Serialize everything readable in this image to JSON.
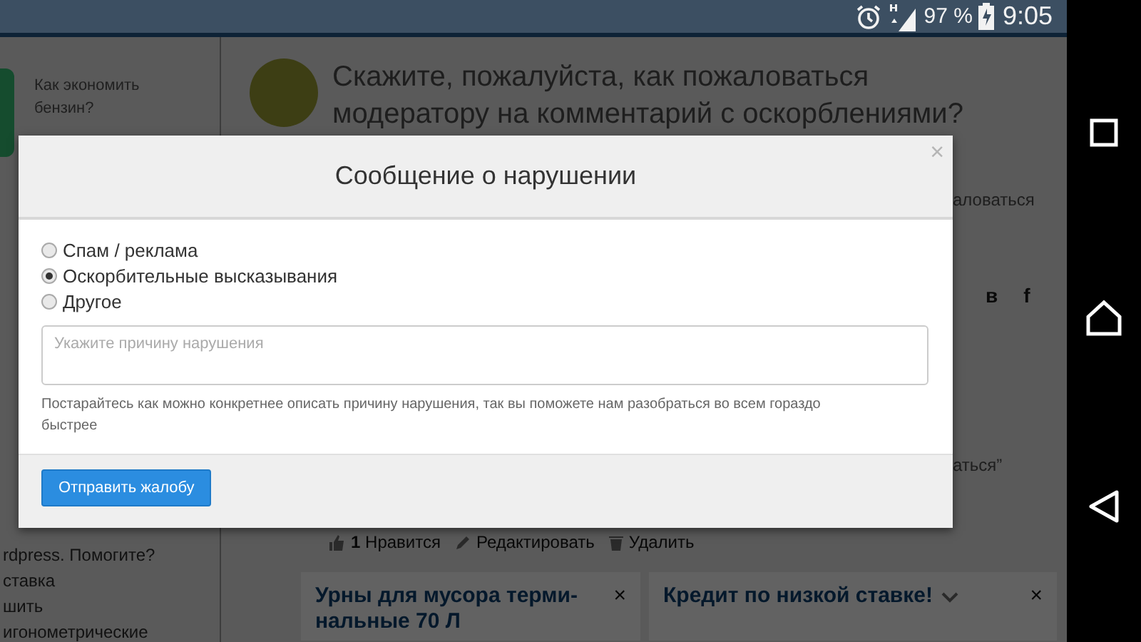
{
  "status_bar": {
    "battery_text": "97 %",
    "time": "9:05"
  },
  "sidebar": {
    "items": [
      {
        "text": "Как экономить бензин?"
      }
    ],
    "lower_texts": [
      "rdpress. Помогите?",
      "ставка",
      "шить",
      "игонометрические"
    ]
  },
  "question": {
    "title": "Скажите, пожалуйста, как пожаловаться модератору на комментарий с оскорблениями?",
    "side_text": "аловаться",
    "share_buttons": [
      "в",
      "f"
    ],
    "quote_fragment": "аться”",
    "actions": [
      {
        "kind": "like",
        "label": "**1** Нравится"
      },
      {
        "kind": "edit",
        "label": "Редактировать"
      },
      {
        "kind": "delete",
        "label": "Удалить"
      }
    ]
  },
  "ads": [
    {
      "title": "Урны для мусора терми- нальные 70 Л",
      "close": "×"
    },
    {
      "title": "Кредит по низкой ставке!",
      "close": "×"
    }
  ],
  "dialog": {
    "title": "Сообщение о нарушении",
    "close": "×",
    "options": [
      {
        "label": "Спам / реклама",
        "selected": false
      },
      {
        "label": "Оскорбительные высказывания",
        "selected": true
      },
      {
        "label": "Другое",
        "selected": false
      }
    ],
    "placeholder": "Укажите причину нарушения",
    "hint": "Постарайтесь как можно конкретнее описать причину нарушения, так вы поможете нам разобраться во всем гораздо быстрее",
    "submit": "Отправить жалобу"
  }
}
